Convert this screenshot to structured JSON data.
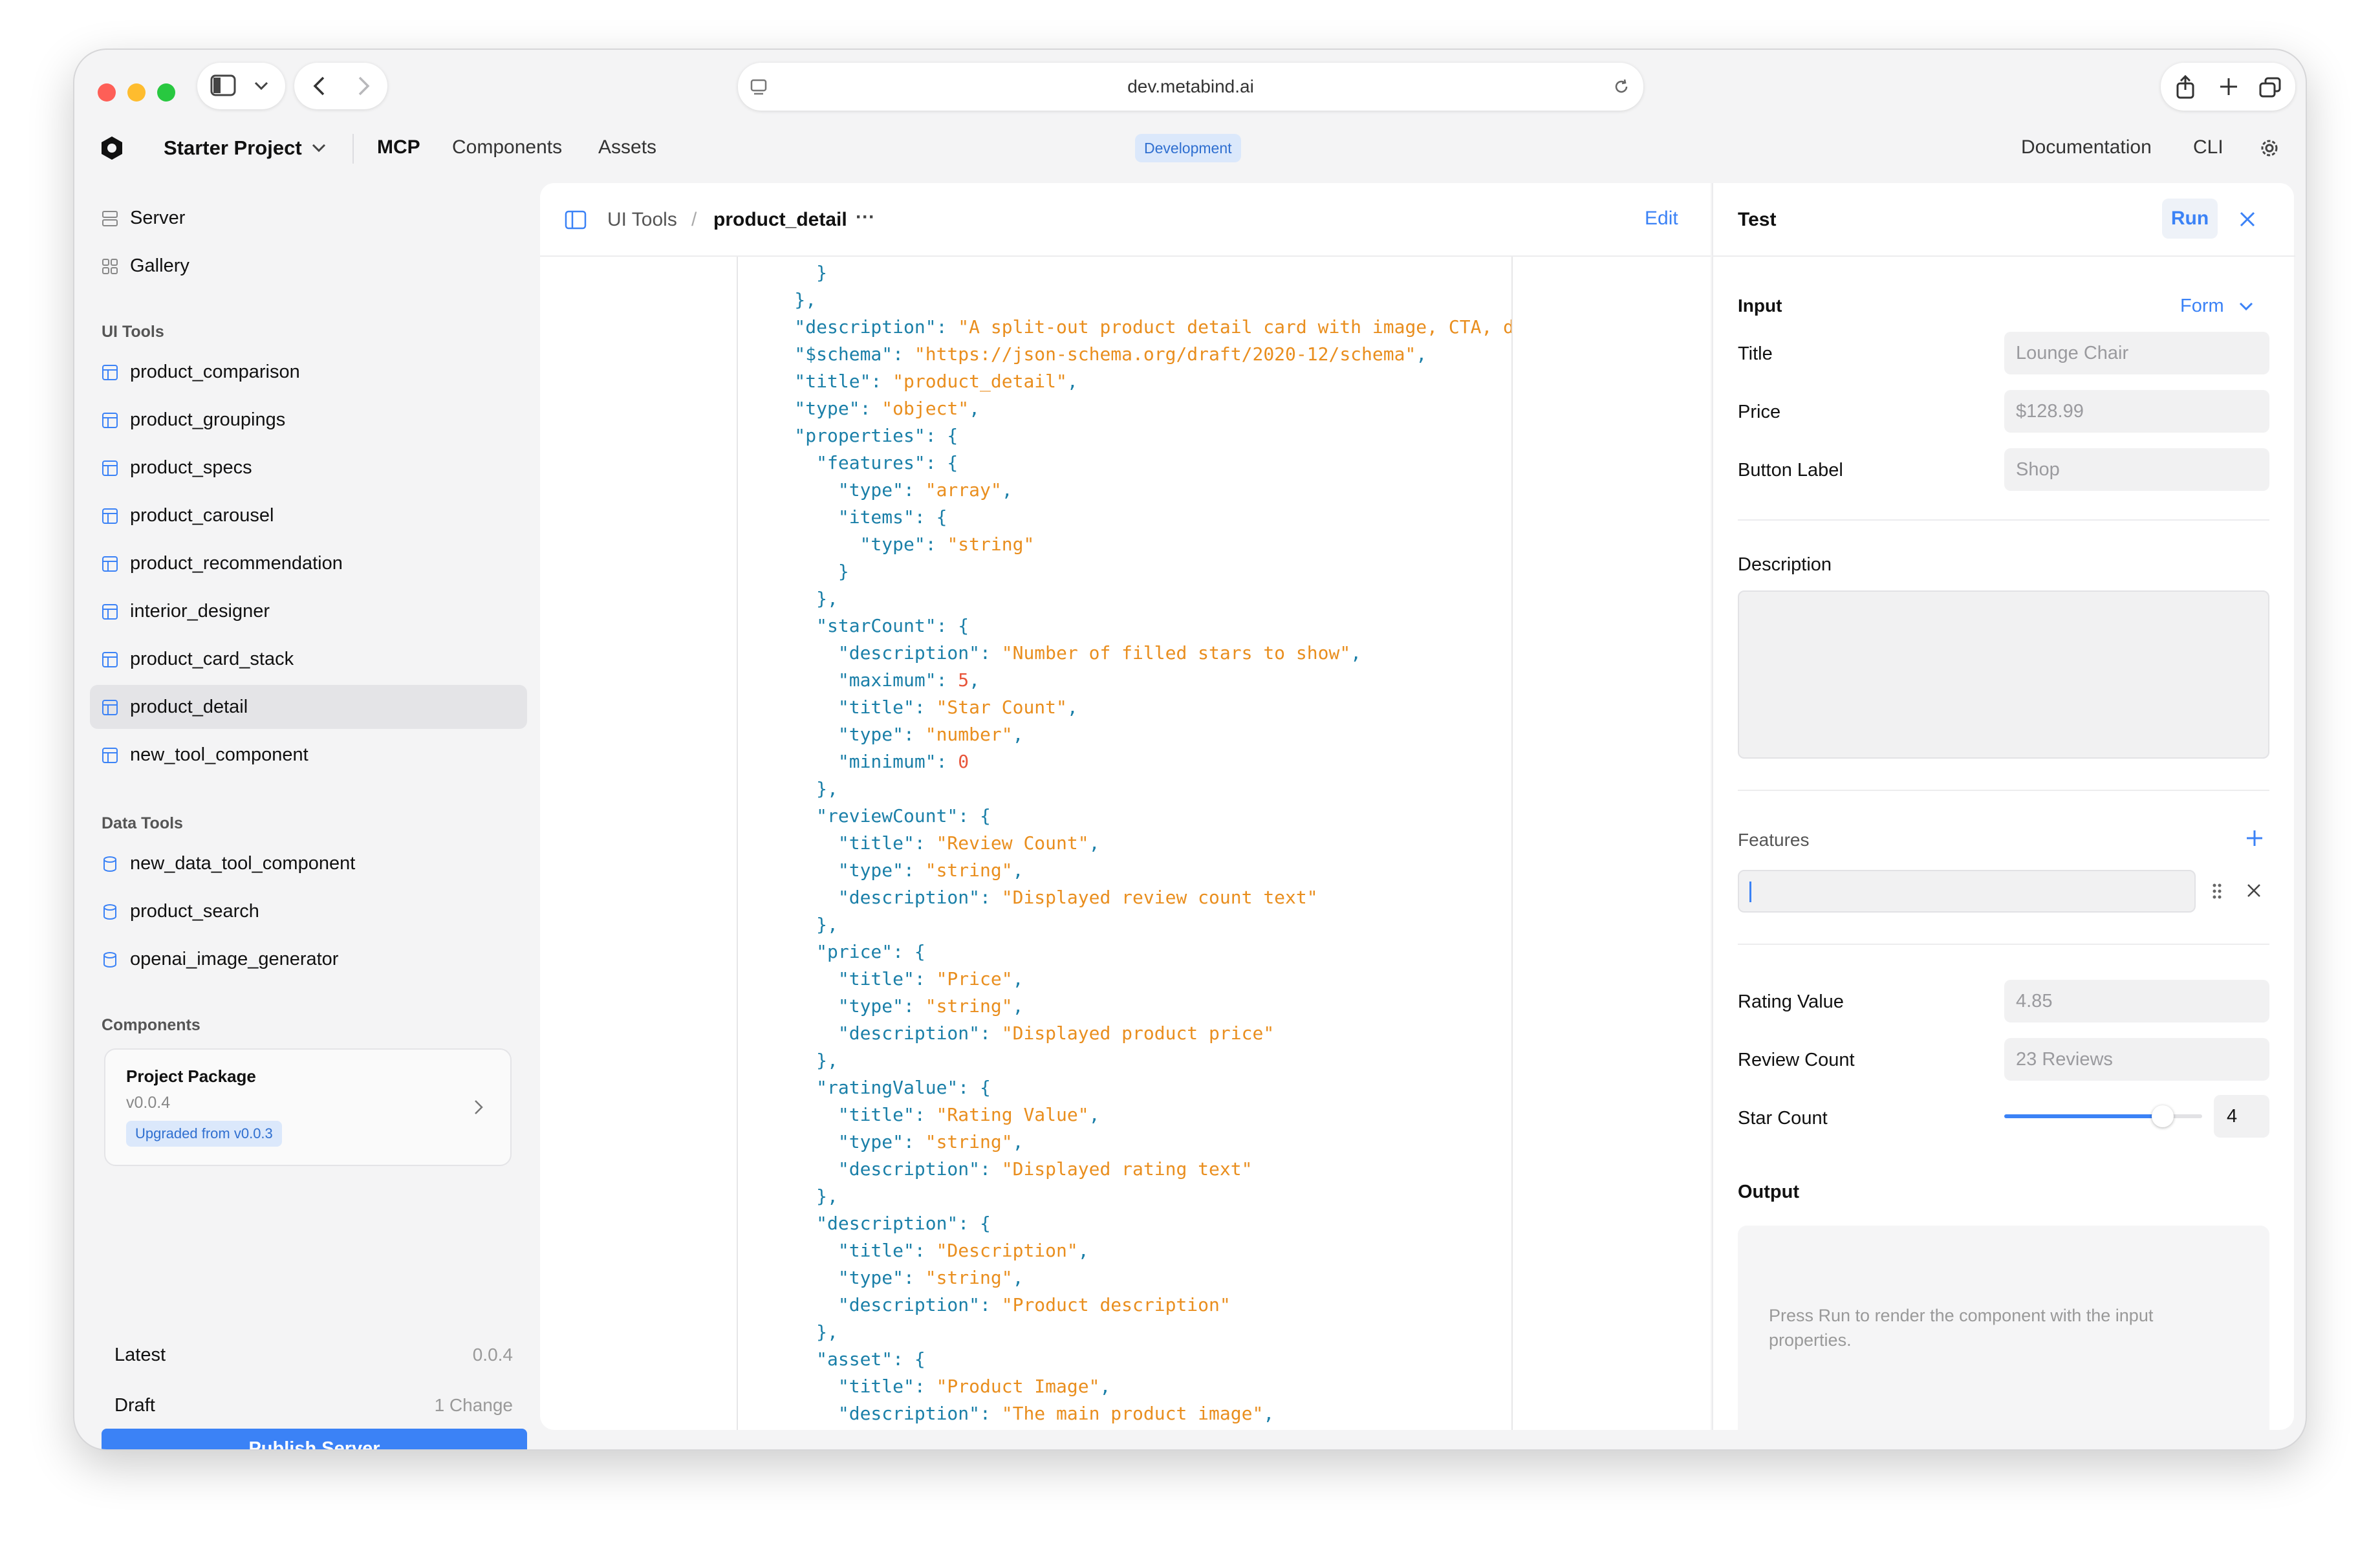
{
  "browser": {
    "url": "dev.metabind.ai"
  },
  "topnav": {
    "project": "Starter Project",
    "tabs": [
      "MCP",
      "Components",
      "Assets"
    ],
    "env_badge": "Development",
    "docs": "Documentation",
    "cli": "CLI"
  },
  "sidebar": {
    "top_items": [
      {
        "label": "Server",
        "icon": "server-icon"
      },
      {
        "label": "Gallery",
        "icon": "gallery-icon"
      }
    ],
    "ui_tools_heading": "UI Tools",
    "ui_tools": [
      "product_comparison",
      "product_groupings",
      "product_specs",
      "product_carousel",
      "product_recommendation",
      "interior_designer",
      "product_card_stack",
      "product_detail",
      "new_tool_component"
    ],
    "selected": "product_detail",
    "data_tools_heading": "Data Tools",
    "data_tools": [
      "new_data_tool_component",
      "product_search",
      "openai_image_generator"
    ],
    "components_heading": "Components",
    "package": {
      "title": "Project Package",
      "version": "v0.0.4",
      "badge": "Upgraded from v0.0.3"
    },
    "latest_label": "Latest",
    "latest_value": "0.0.4",
    "draft_label": "Draft",
    "draft_value": "1 Change",
    "publish_button": "Publish Server"
  },
  "editor": {
    "breadcrumb_parent": "UI Tools",
    "breadcrumb_sep": "/",
    "breadcrumb_current": "product_detail",
    "more": "···",
    "edit_button": "Edit",
    "code_lines": [
      [
        [
          "p",
          "      }"
        ]
      ],
      [
        [
          "p",
          "    },"
        ]
      ],
      [
        [
          "p",
          "    \"description\": "
        ],
        [
          "s",
          "\"A split-out product detail card with image, CTA, des"
        ]
      ],
      [
        [
          "p",
          "    \"$schema\": "
        ],
        [
          "s",
          "\"https://json-schema.org/draft/2020-12/schema\""
        ],
        [
          "p",
          ","
        ]
      ],
      [
        [
          "p",
          "    \"title\": "
        ],
        [
          "s",
          "\"product_detail\""
        ],
        [
          "p",
          ","
        ]
      ],
      [
        [
          "p",
          "    \"type\": "
        ],
        [
          "s",
          "\"object\""
        ],
        [
          "p",
          ","
        ]
      ],
      [
        [
          "p",
          "    \"properties\": {"
        ]
      ],
      [
        [
          "p",
          "      \"features\": {"
        ]
      ],
      [
        [
          "p",
          "        \"type\": "
        ],
        [
          "s",
          "\"array\""
        ],
        [
          "p",
          ","
        ]
      ],
      [
        [
          "p",
          "        \"items\": {"
        ]
      ],
      [
        [
          "p",
          "          \"type\": "
        ],
        [
          "s",
          "\"string\""
        ]
      ],
      [
        [
          "p",
          "        }"
        ]
      ],
      [
        [
          "p",
          "      },"
        ]
      ],
      [
        [
          "p",
          "      \"starCount\": {"
        ]
      ],
      [
        [
          "p",
          "        \"description\": "
        ],
        [
          "s",
          "\"Number of filled stars to show\""
        ],
        [
          "p",
          ","
        ]
      ],
      [
        [
          "p",
          "        \"maximum\": "
        ],
        [
          "n",
          "5"
        ],
        [
          "p",
          ","
        ]
      ],
      [
        [
          "p",
          "        \"title\": "
        ],
        [
          "s",
          "\"Star Count\""
        ],
        [
          "p",
          ","
        ]
      ],
      [
        [
          "p",
          "        \"type\": "
        ],
        [
          "s",
          "\"number\""
        ],
        [
          "p",
          ","
        ]
      ],
      [
        [
          "p",
          "        \"minimum\": "
        ],
        [
          "n",
          "0"
        ]
      ],
      [
        [
          "p",
          "      },"
        ]
      ],
      [
        [
          "p",
          "      \"reviewCount\": {"
        ]
      ],
      [
        [
          "p",
          "        \"title\": "
        ],
        [
          "s",
          "\"Review Count\""
        ],
        [
          "p",
          ","
        ]
      ],
      [
        [
          "p",
          "        \"type\": "
        ],
        [
          "s",
          "\"string\""
        ],
        [
          "p",
          ","
        ]
      ],
      [
        [
          "p",
          "        \"description\": "
        ],
        [
          "s",
          "\"Displayed review count text\""
        ]
      ],
      [
        [
          "p",
          "      },"
        ]
      ],
      [
        [
          "p",
          "      \"price\": {"
        ]
      ],
      [
        [
          "p",
          "        \"title\": "
        ],
        [
          "s",
          "\"Price\""
        ],
        [
          "p",
          ","
        ]
      ],
      [
        [
          "p",
          "        \"type\": "
        ],
        [
          "s",
          "\"string\""
        ],
        [
          "p",
          ","
        ]
      ],
      [
        [
          "p",
          "        \"description\": "
        ],
        [
          "s",
          "\"Displayed product price\""
        ]
      ],
      [
        [
          "p",
          "      },"
        ]
      ],
      [
        [
          "p",
          "      \"ratingValue\": {"
        ]
      ],
      [
        [
          "p",
          "        \"title\": "
        ],
        [
          "s",
          "\"Rating Value\""
        ],
        [
          "p",
          ","
        ]
      ],
      [
        [
          "p",
          "        \"type\": "
        ],
        [
          "s",
          "\"string\""
        ],
        [
          "p",
          ","
        ]
      ],
      [
        [
          "p",
          "        \"description\": "
        ],
        [
          "s",
          "\"Displayed rating text\""
        ]
      ],
      [
        [
          "p",
          "      },"
        ]
      ],
      [
        [
          "p",
          "      \"description\": {"
        ]
      ],
      [
        [
          "p",
          "        \"title\": "
        ],
        [
          "s",
          "\"Description\""
        ],
        [
          "p",
          ","
        ]
      ],
      [
        [
          "p",
          "        \"type\": "
        ],
        [
          "s",
          "\"string\""
        ],
        [
          "p",
          ","
        ]
      ],
      [
        [
          "p",
          "        \"description\": "
        ],
        [
          "s",
          "\"Product description\""
        ]
      ],
      [
        [
          "p",
          "      },"
        ]
      ],
      [
        [
          "p",
          "      \"asset\": {"
        ]
      ],
      [
        [
          "p",
          "        \"title\": "
        ],
        [
          "s",
          "\"Product Image\""
        ],
        [
          "p",
          ","
        ]
      ],
      [
        [
          "p",
          "        \"description\": "
        ],
        [
          "s",
          "\"The main product image\""
        ],
        [
          "p",
          ","
        ]
      ]
    ]
  },
  "test": {
    "title": "Test",
    "run_button": "Run",
    "input_label": "Input",
    "form_toggle": "Form",
    "title_label": "Title",
    "title_placeholder": "Lounge Chair",
    "price_label": "Price",
    "price_placeholder": "$128.99",
    "button_label_label": "Button Label",
    "button_label_placeholder": "Shop",
    "description_label": "Description",
    "features_label": "Features",
    "rating_label": "Rating Value",
    "rating_placeholder": "4.85",
    "review_label": "Review Count",
    "review_placeholder": "23 Reviews",
    "star_label": "Star Count",
    "star_value": "4",
    "star_min": 0,
    "star_max": 5,
    "output_label": "Output",
    "output_hint": "Press Run to render the component with the input properties."
  },
  "colors": {
    "accent": "#3b82f6",
    "badge_bg": "#dbe8fb",
    "badge_text": "#2f6fd0"
  }
}
